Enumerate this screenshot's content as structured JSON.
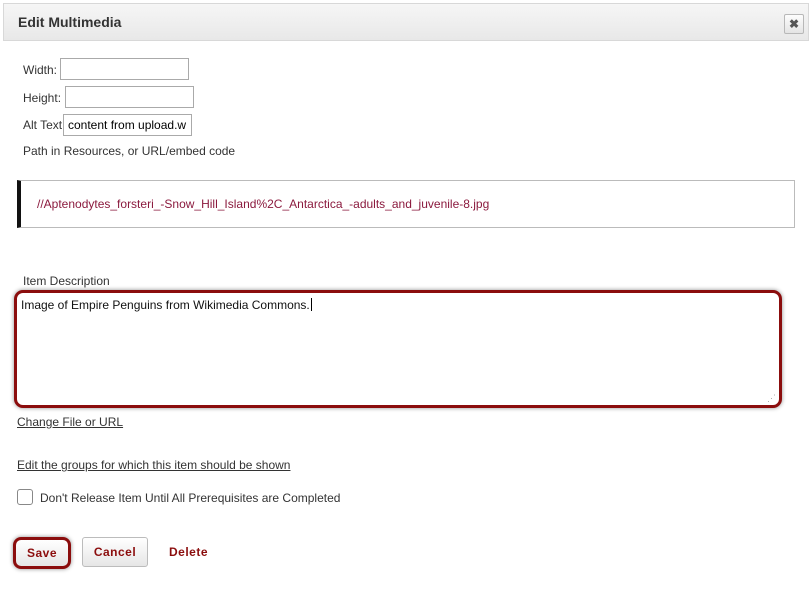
{
  "dialog": {
    "title": "Edit Multimedia",
    "close_icon": "close-icon",
    "close_glyph": "✖"
  },
  "form": {
    "width_label": "Width:",
    "width_value": "",
    "height_label": "Height:",
    "height_value": "",
    "alt_label": "Alt Text",
    "alt_value": "content from upload.w",
    "path_label": "Path in Resources, or URL/embed code",
    "path_value": "//Aptenodytes_forsteri_-Snow_Hill_Island%2C_Antarctica_-adults_and_juvenile-8.jpg",
    "description_label": "Item Description",
    "description_value": "Image of Empire Penguins from Wikimedia Commons.",
    "change_file_link": "Change File or URL",
    "edit_groups_link": "Edit the groups for which this item should be shown",
    "prereq_label": "Don't Release Item Until All Prerequisites are Completed",
    "prereq_checked": false
  },
  "actions": {
    "save_label": "Save",
    "cancel_label": "Cancel",
    "delete_label": "Delete"
  },
  "colors": {
    "accent": "#8b0d0d",
    "path_text": "#8b1a3e"
  }
}
